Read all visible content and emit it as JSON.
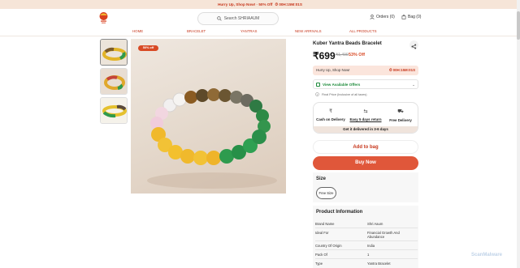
{
  "promo": {
    "text": "Hurry Up, Shop Now! · 50% Off",
    "timer": "⏱ 00H:15M:01S"
  },
  "header": {
    "search_placeholder": "Search SHRIAAUM",
    "orders": "Orders (0)",
    "bag": "Bag (0)"
  },
  "nav": [
    "HOME",
    "BRACELET",
    "YANTRAS",
    "NEW ARRIVALS",
    "ALL PRODUCTS"
  ],
  "product": {
    "badge": "50% off",
    "title": "Kuber Yantra Beads Bracelet",
    "price": "₹699",
    "mrp": "₹1,499",
    "discount": "53% Off",
    "hurry_text": "Hurry Up, Shop Now!",
    "hurry_timer": "⏱ 00H:15M:01S",
    "offers_label": "View Available Offers",
    "tax_note": "Final Price (Inclusive of all taxes)",
    "delivery": {
      "cod": "Cash on Delivery",
      "returns": "Easy 5 days return",
      "free": "Free Delivery",
      "eta": "Get it delivered in 3-6 days"
    },
    "add_to_bag": "Add to bag",
    "buy_now": "Buy Now",
    "size_title": "Size",
    "size_option": "Free Size",
    "info_title": "Product Information",
    "info": [
      {
        "k": "Brand Name",
        "v": "Shri Aaum"
      },
      {
        "k": "Ideal For",
        "v": "Financial Growth And Abundance"
      },
      {
        "k": "Country Of Origin",
        "v": "India"
      },
      {
        "k": "Pack Of",
        "v": "1"
      },
      {
        "k": "Type",
        "v": "Yantra Bracelet"
      }
    ]
  },
  "watermark": "ScanMalware"
}
